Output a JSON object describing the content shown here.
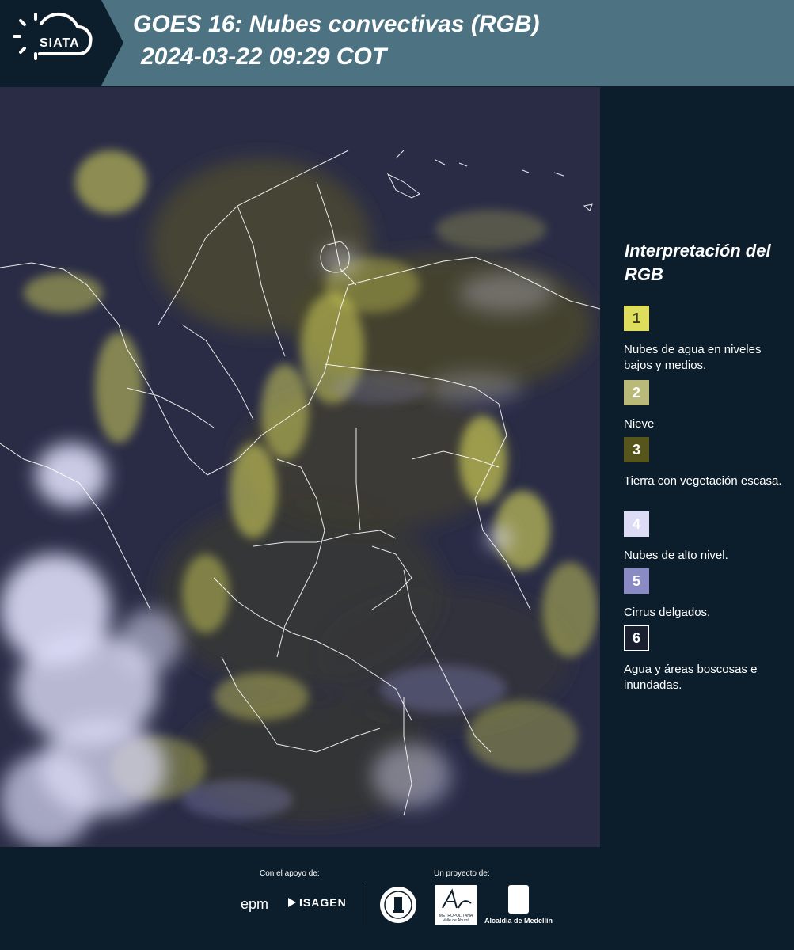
{
  "header": {
    "logo_text": "SIATA",
    "title_line1": "GOES 16: Nubes convectivas (RGB)",
    "title_line2": "2024-03-22 09:29 COT"
  },
  "legend": {
    "title": "Interpretación del RGB",
    "items": [
      {
        "number": "1",
        "label": "Nubes de agua en niveles bajos y medios.",
        "color": "#dedd5c",
        "text_color": "#3a3a1a"
      },
      {
        "number": "2",
        "label": "Nieve",
        "color": "#b9b979",
        "text_color": "#ffffff"
      },
      {
        "number": "3",
        "label": "Tierra con vegetación escasa.",
        "color": "#56561c",
        "text_color": "#ffffff"
      },
      {
        "number": "4",
        "label": "Nubes de alto nivel.",
        "color": "#dcdcf6",
        "text_color": "#ffffff"
      },
      {
        "number": "5",
        "label": "Cirrus delgados.",
        "color": "#8a8ac4",
        "text_color": "#ffffff"
      },
      {
        "number": "6",
        "label": "Agua y áreas boscosas e inundadas.",
        "color": "#1a2030",
        "text_color": "#ffffff"
      }
    ]
  },
  "footer": {
    "support_label": "Con el apoyo de:",
    "project_label": "Un proyecto de:",
    "sponsor_epm": "epm",
    "sponsor_isagen": "ISAGEN",
    "partner_amva": "METROPOLITANA Valle de Aburrá",
    "partner_alcaldia": "Alcaldía de Medellín"
  },
  "colors": {
    "header_bg": "#4d7382",
    "panel_bg": "#0c1e2b",
    "map_dark": "#2a2c46",
    "cloud_yellow": "#dedd5c",
    "cloud_white": "#dcdcf6",
    "border_line": "#ffffff"
  }
}
